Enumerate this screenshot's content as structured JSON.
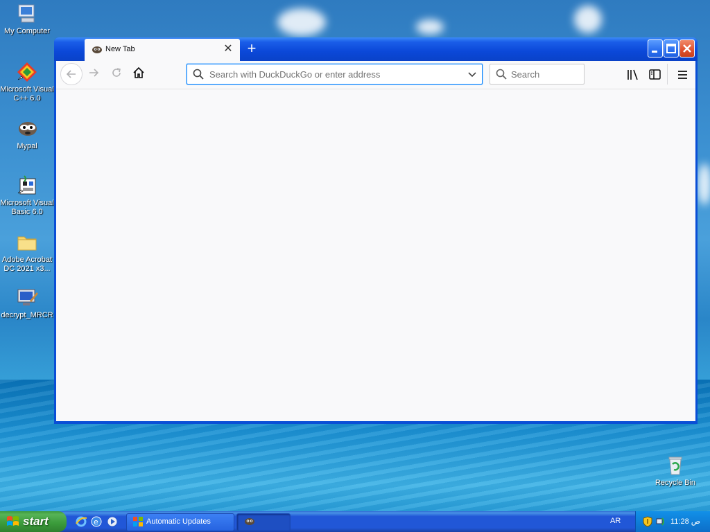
{
  "desktop": {
    "icons": [
      {
        "label": "My Computer",
        "icon": "my-computer-icon"
      },
      {
        "label": "Microsoft Visual C++ 6.0",
        "icon": "visual-cpp-icon"
      },
      {
        "label": "Mypal",
        "icon": "mypal-icon"
      },
      {
        "label": "Microsoft Visual Basic 6.0",
        "icon": "visual-basic-icon"
      },
      {
        "label": "Adobe Acrobat DC 2021 x3...",
        "icon": "folder-icon"
      },
      {
        "label": "decrypt_MRCR",
        "icon": "decrypt-app-icon"
      },
      {
        "label": "Recycle Bin",
        "icon": "recycle-bin-icon"
      }
    ]
  },
  "browser": {
    "tab": {
      "title": "New Tab",
      "close": "✕"
    },
    "new_tab": "+",
    "url_placeholder": "Search with DuckDuckGo or enter address",
    "search_placeholder": "Search",
    "accent": "#0a84ff"
  },
  "taskbar": {
    "start_label": "start",
    "tasks": [
      {
        "label": "Automatic Updates"
      },
      {
        "label": ""
      }
    ],
    "language": "AR",
    "clock": "11:28 ص"
  }
}
